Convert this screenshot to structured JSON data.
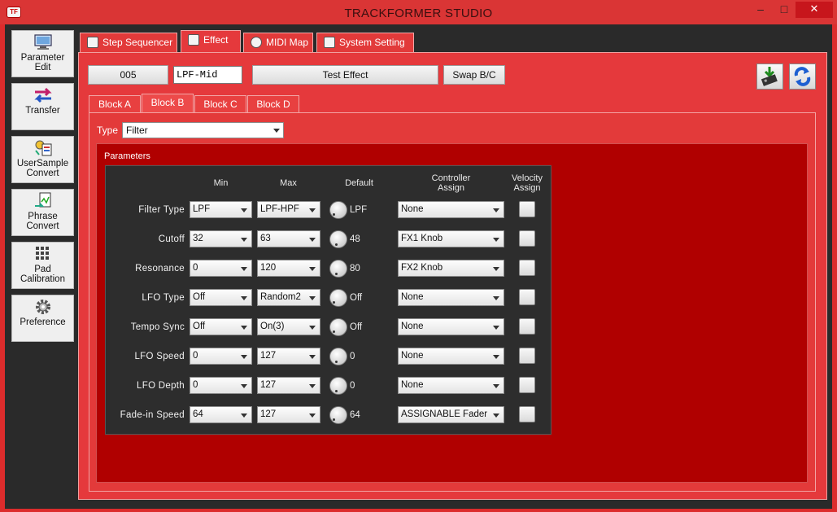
{
  "window": {
    "title": "TRACKFORMER STUDIO",
    "app_icon": "TF",
    "min": "–",
    "max": "□",
    "close": "✕"
  },
  "sidebar": {
    "items": [
      {
        "label": "Parameter\nEdit"
      },
      {
        "label": "Transfer"
      },
      {
        "label": "UserSample\nConvert"
      },
      {
        "label": "Phrase\nConvert"
      },
      {
        "label": "Pad\nCalibration"
      },
      {
        "label": "Preference"
      }
    ]
  },
  "tabs": [
    {
      "label": "Step Sequencer"
    },
    {
      "label": "Effect"
    },
    {
      "label": "MIDI Map"
    },
    {
      "label": "System Setting"
    }
  ],
  "effect": {
    "number": "005",
    "name": "LPF-Mid",
    "test_label": "Test Effect",
    "swap_label": "Swap B/C"
  },
  "blocks": [
    {
      "label": "Block A"
    },
    {
      "label": "Block B"
    },
    {
      "label": "Block C"
    },
    {
      "label": "Block D"
    }
  ],
  "type": {
    "label": "Type",
    "value": "Filter"
  },
  "parameters": {
    "legend": "Parameters",
    "headers": {
      "min": "Min",
      "max": "Max",
      "default": "Default",
      "controller": "Controller\nAssign",
      "velocity": "Velocity\nAssign"
    },
    "rows": [
      {
        "name": "Filter Type",
        "min": "LPF",
        "max": "LPF-HPF",
        "default": "LPF",
        "controller": "None",
        "velocity": false
      },
      {
        "name": "Cutoff",
        "min": "32",
        "max": "63",
        "default": "48",
        "controller": "FX1 Knob",
        "velocity": false
      },
      {
        "name": "Resonance",
        "min": "0",
        "max": "120",
        "default": "80",
        "controller": "FX2 Knob",
        "velocity": false
      },
      {
        "name": "LFO Type",
        "min": "Off",
        "max": "Random2",
        "default": "Off",
        "controller": "None",
        "velocity": false
      },
      {
        "name": "Tempo Sync",
        "min": "Off",
        "max": "On(3)",
        "default": "Off",
        "controller": "None",
        "velocity": false
      },
      {
        "name": "LFO Speed",
        "min": "0",
        "max": "127",
        "default": "0",
        "controller": "None",
        "velocity": false
      },
      {
        "name": "LFO Depth",
        "min": "0",
        "max": "127",
        "default": "0",
        "controller": "None",
        "velocity": false
      },
      {
        "name": "Fade-in Speed",
        "min": "64",
        "max": "127",
        "default": "64",
        "controller": "ASSIGNABLE Fader",
        "velocity": false
      }
    ]
  }
}
